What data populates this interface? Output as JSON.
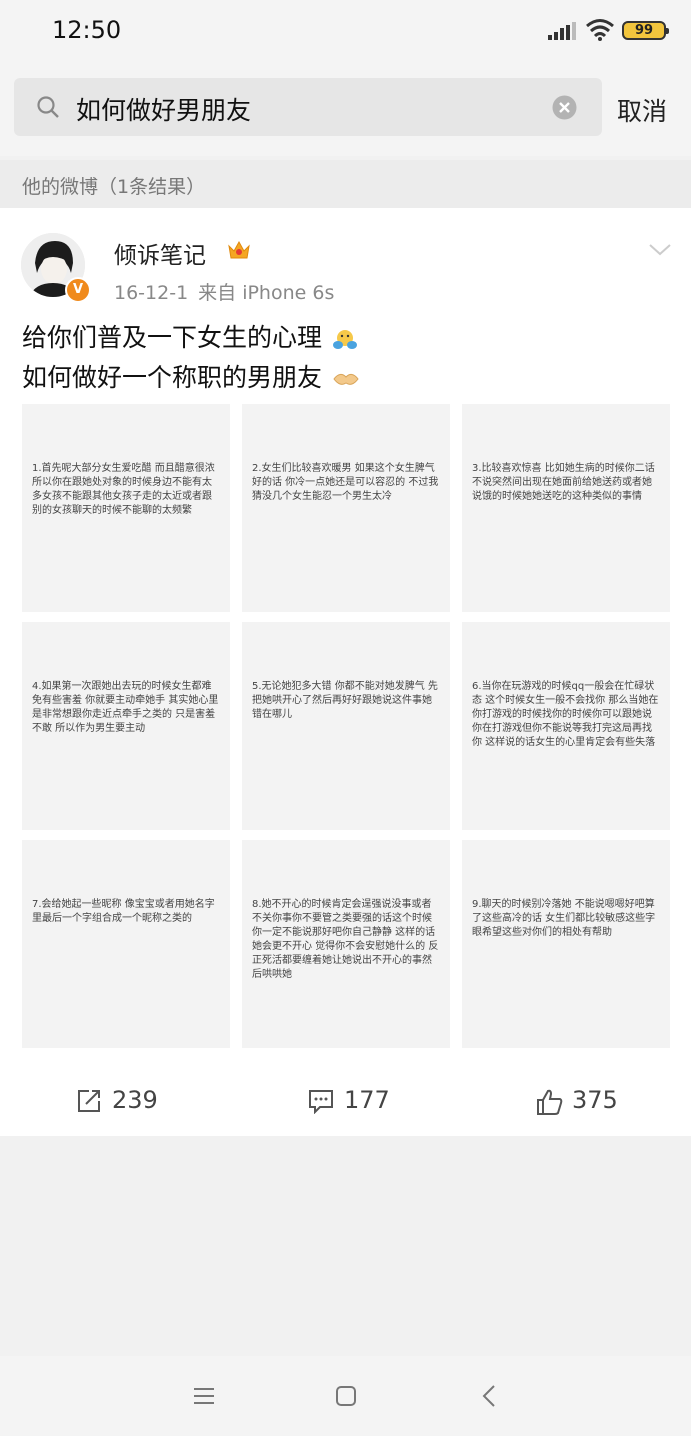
{
  "status": {
    "time": "12:50",
    "battery": "99"
  },
  "search": {
    "query": "如何做好男朋友",
    "cancel_label": "取消"
  },
  "section": {
    "title": "他的微博（1条结果）"
  },
  "post": {
    "username": "倾诉笔记",
    "date": "16-12-1",
    "source": "来自 iPhone 6s",
    "line1": "给你们普及一下女生的心理",
    "line2": "如何做好一个称职的男朋友",
    "images": [
      "1.首先呢大部分女生爱吃醋 而且醋意很浓 所以你在跟她处对象的时候身边不能有太多女孩不能跟其他女孩子走的太近或者跟别的女孩聊天的时候不能聊的太频繁",
      "2.女生们比较喜欢暖男 如果这个女生脾气好的话 你冷一点她还是可以容忍的 不过我猜没几个女生能忍一个男生太冷",
      "3.比较喜欢惊喜 比如她生病的时候你二话不说突然间出现在她面前给她送药或者她说饿的时候她她送吃的这种类似的事情",
      "4.如果第一次跟她出去玩的时候女生都难免有些害羞 你就要主动牵她手 其实她心里是非常想跟你走近点牵手之类的 只是害羞不敢 所以作为男生要主动",
      "5.无论她犯多大错 你都不能对她发脾气 先把她哄开心了然后再好好跟她说这件事她错在哪儿",
      "6.当你在玩游戏的时候qq一般会在忙碌状态 这个时候女生一般不会找你 那么当她在你打游戏的时候找你的时候你可以跟她说你在打游戏但你不能说等我打完这局再找你 这样说的话女生的心里肯定会有些失落",
      "7.会给她起一些昵称 像宝宝或者用她名字里最后一个字组合成一个昵称之类的",
      "8.她不开心的时候肯定会逞强说没事或者不关你事你不要管之类要强的话这个时候你一定不能说那好吧你自己静静 这样的话她会更不开心 觉得你不会安慰她什么的 反正死活都要缠着她让她说出不开心的事然后哄哄她",
      "9.聊天的时候别冷落她 不能说嗯嗯好吧算了这些高冷的话 女生们都比较敏感这些字眼希望这些对你们的相处有帮助"
    ],
    "reposts": "239",
    "comments": "177",
    "likes": "375"
  }
}
